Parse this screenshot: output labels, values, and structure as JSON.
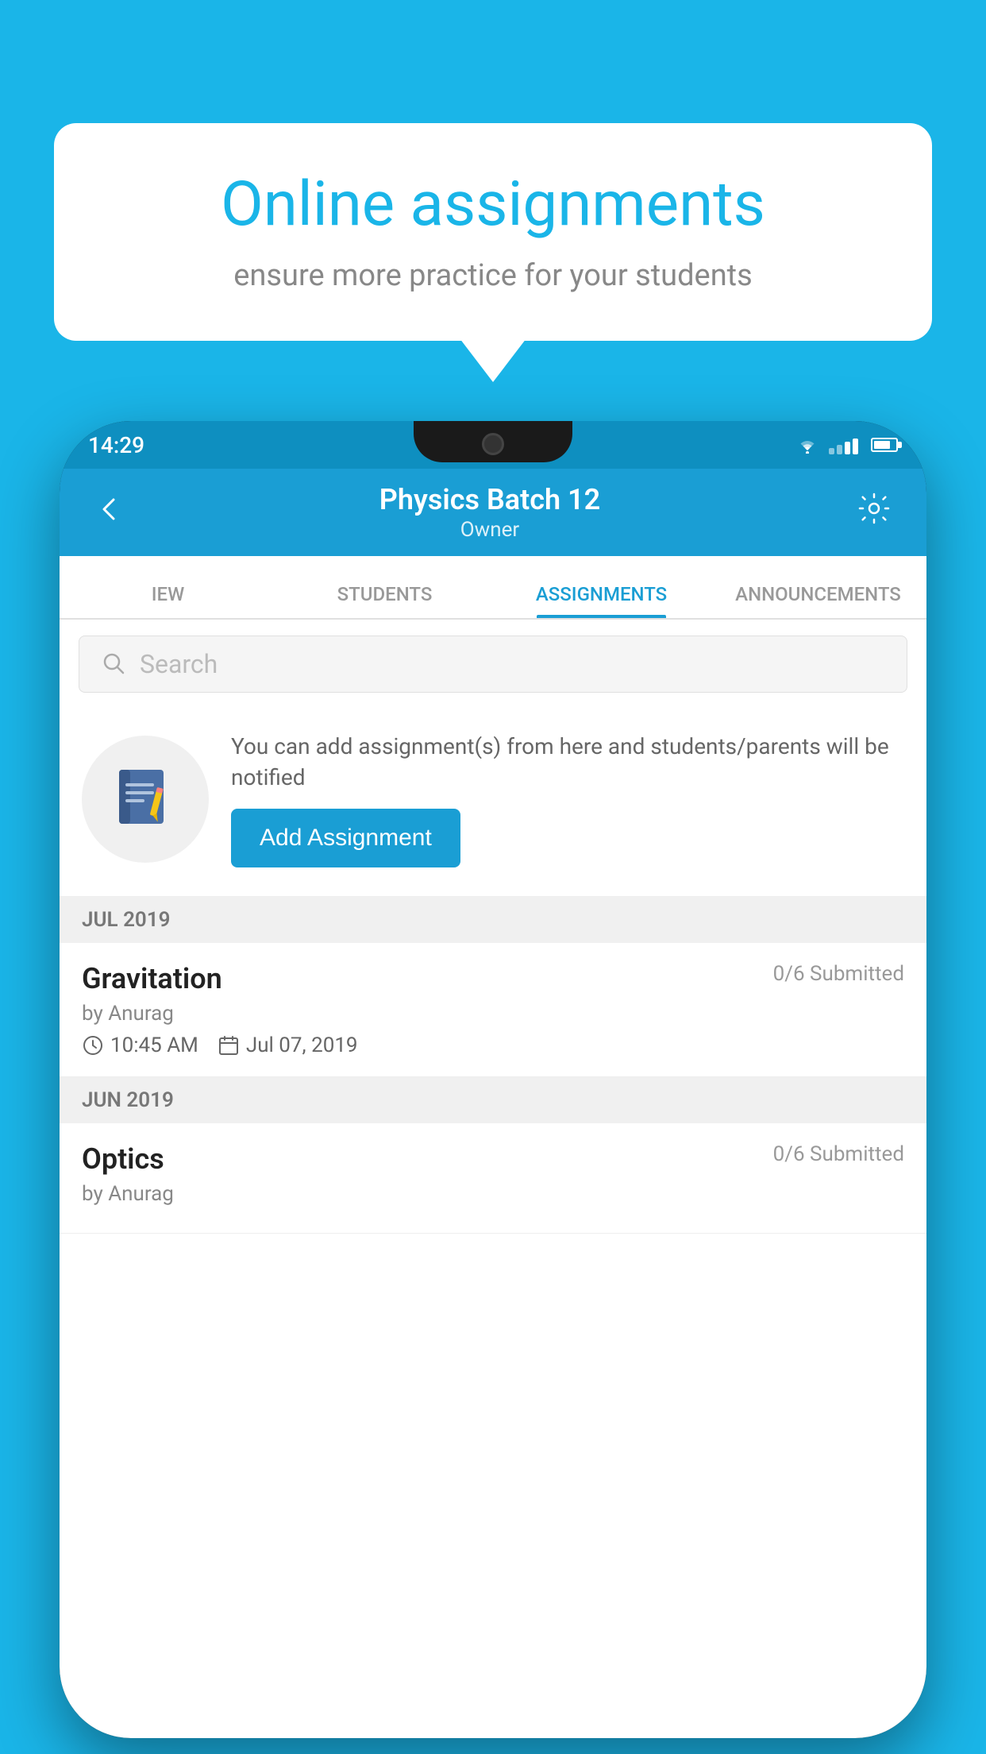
{
  "background": {
    "color": "#1ab5e8"
  },
  "speech_bubble": {
    "title": "Online assignments",
    "subtitle": "ensure more practice for your students"
  },
  "phone": {
    "status_bar": {
      "time": "14:29"
    },
    "app_bar": {
      "title": "Physics Batch 12",
      "subtitle": "Owner",
      "back_label": "←",
      "settings_label": "⚙"
    },
    "tabs": [
      {
        "label": "IEW",
        "active": false
      },
      {
        "label": "STUDENTS",
        "active": false
      },
      {
        "label": "ASSIGNMENTS",
        "active": true
      },
      {
        "label": "ANNOUNCEMENTS",
        "active": false
      }
    ],
    "search": {
      "placeholder": "Search"
    },
    "info_card": {
      "description": "You can add assignment(s) from here and students/parents will be notified",
      "add_button_label": "Add Assignment"
    },
    "sections": [
      {
        "header": "JUL 2019",
        "assignments": [
          {
            "title": "Gravitation",
            "submitted": "0/6 Submitted",
            "by": "by Anurag",
            "time": "10:45 AM",
            "date": "Jul 07, 2019"
          }
        ]
      },
      {
        "header": "JUN 2019",
        "assignments": [
          {
            "title": "Optics",
            "submitted": "0/6 Submitted",
            "by": "by Anurag",
            "time": "",
            "date": ""
          }
        ]
      }
    ]
  }
}
